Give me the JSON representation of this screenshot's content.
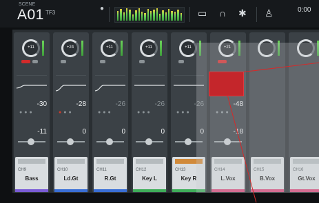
{
  "topbar": {
    "scene_small": "SCENE",
    "scene_number": "A01",
    "scene_sub": "TF3",
    "time": "0:00"
  },
  "icons": [
    "info-icon",
    "meter-strip",
    "monitor-icon",
    "headphones-icon",
    "gear-icon",
    "user-icon"
  ],
  "channels": [
    {
      "knob": "+11",
      "gate": "-30",
      "comp": "-11",
      "id": "CH9",
      "name": "Bass",
      "color": "#7a5cd6"
    },
    {
      "knob": "+24",
      "gate": "-28",
      "comp": "0",
      "id": "CH10",
      "name": "Ld.Gt",
      "color": "#3a6fd6"
    },
    {
      "knob": "+11",
      "gate": "-26",
      "comp": "0",
      "id": "CH11",
      "name": "R.Gt",
      "color": "#3a6fd6"
    },
    {
      "knob": "+11",
      "gate": "-26",
      "comp": "0",
      "id": "CH12",
      "name": "Key L",
      "color": "#3fae5a"
    },
    {
      "knob": "+11",
      "gate": "-26",
      "comp": "0",
      "id": "CH13",
      "name": "Key R",
      "color": "#3fae5a"
    },
    {
      "knob": "+21",
      "gate": "-48",
      "comp": "-18",
      "id": "CH14",
      "name": "L.Vox",
      "color": "#d94a7a"
    },
    {
      "knob": "",
      "gate": "",
      "comp": "",
      "id": "CH15",
      "name": "B.Vox",
      "color": "#d94a7a"
    },
    {
      "knob": "",
      "gate": "",
      "comp": "",
      "id": "CH16",
      "name": "Gt.Vox",
      "color": "#d94a7a"
    }
  ],
  "colors": {
    "accent_red": "#c4262b",
    "panel": "#2a2f33",
    "strip": "#3b4146"
  }
}
